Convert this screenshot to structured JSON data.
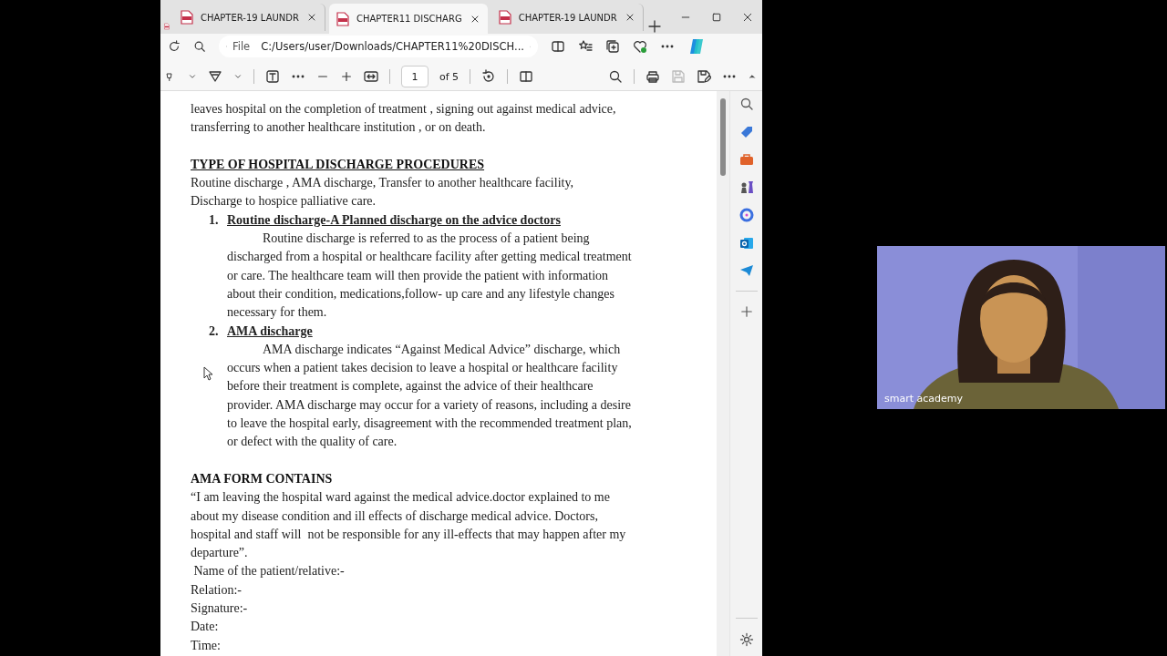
{
  "browser": {
    "tabs": [
      {
        "label": "CHAPTER-19 LAUNDR",
        "selected": false
      },
      {
        "label": "CHAPTER11 DISCHARG",
        "selected": true
      },
      {
        "label": "CHAPTER-19 LAUNDR",
        "selected": false
      }
    ],
    "address_bar": {
      "scheme": "File",
      "url": "C:/Users/user/Downloads/CHAPTER11%20DISCH..."
    },
    "pdf_toolbar": {
      "page_number": "1",
      "page_count": "of 5",
      "save_disabled": true
    }
  },
  "document": {
    "blocks": [
      {
        "kind": "paragraph",
        "text": "leaves hospital on the completion of treatment , signing out against medical advice, transferring to another healthcare institution , or on death."
      },
      {
        "kind": "spacer"
      },
      {
        "kind": "heading",
        "text": "TYPE OF HOSPITAL DISCHARGE PROCEDURES",
        "underlined": true
      },
      {
        "kind": "paragraph",
        "text": "Routine discharge , AMA discharge, Transfer to another healthcare facility, Discharge to hospice palliative care."
      },
      {
        "kind": "numbered_heading",
        "number": "1.",
        "text": "Routine discharge-A Planned discharge on the advice doctors"
      },
      {
        "kind": "indented_paragraph",
        "text": "Routine discharge is referred to as the process of a patient being discharged from a hospital or healthcare facility after getting medical treatment or care. The healthcare team will then provide the patient with information about their condition, medications,follow- up care and any lifestyle changes necessary for them."
      },
      {
        "kind": "numbered_heading",
        "number": "2.",
        "text": "AMA discharge"
      },
      {
        "kind": "indented_paragraph",
        "text": "AMA discharge indicates “Against Medical Advice” discharge, which occurs when a patient takes decision to leave a hospital or healthcare facility before their treatment is complete, against the advice of their healthcare provider. AMA discharge may occur for a variety of reasons, including a desire to leave the hospital early, disagreement with the recommended treatment plan, or defect with the quality of care."
      },
      {
        "kind": "spacer"
      },
      {
        "kind": "heading",
        "text": "AMA FORM CONTAINS",
        "underlined": false
      },
      {
        "kind": "paragraph",
        "text": "“I am leaving the hospital ward against the medical advice.doctor explained to me about my disease condition and ill effects of discharge medical advice. Doctors, hospital and staff will  not be responsible for any ill-effects that may happen after my departure”."
      },
      {
        "kind": "paragraph",
        "text": " Name of the patient/relative:-"
      },
      {
        "kind": "paragraph",
        "text": "Relation:-"
      },
      {
        "kind": "paragraph",
        "text": "Signature:-"
      },
      {
        "kind": "paragraph",
        "text": "Date:"
      },
      {
        "kind": "paragraph",
        "text": "Time:"
      }
    ]
  },
  "webcam": {
    "kind": "picture",
    "name_label": "smart academy"
  }
}
